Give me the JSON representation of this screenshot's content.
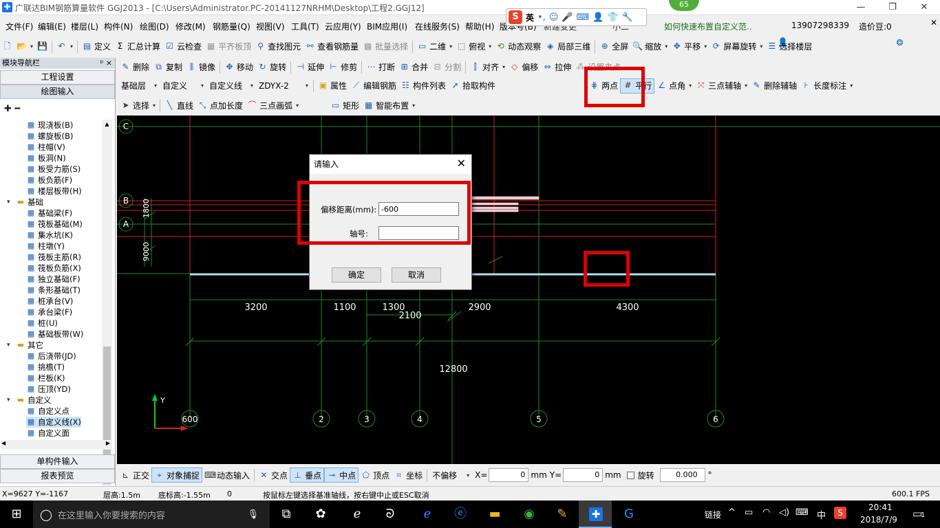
{
  "titlebar": {
    "title": "广联达BIM钢筋算量软件 GGJ2013 - [C:\\Users\\Administrator.PC-20141127NRHM\\Desktop\\工程2.GGJ12]",
    "min": "—",
    "max": "❐",
    "close": "✕"
  },
  "ime": {
    "label": "英",
    "badge": "65"
  },
  "menubar": {
    "items": [
      "文件(F)",
      "编辑(E)",
      "楼层(L)",
      "构件(N)",
      "绘图(D)",
      "修改(M)",
      "钢筋量(Q)",
      "视图(V)",
      "工具(T)",
      "云应用(Y)",
      "BIM应用(I)",
      "在线服务(S)",
      "帮助(H)",
      "版本号(B)",
      "新建变更",
      "小二"
    ],
    "tip": "如何快速布置自定义范..",
    "phone": "13907298339",
    "coins": "造价豆:0"
  },
  "toolbar1": {
    "items": [
      "定义",
      "汇总计算",
      "云检查",
      "平齐板顶",
      "查找图元",
      "查看钢筋量",
      "批量选择",
      "二维",
      "俯视",
      "动态观察",
      "局部三维",
      "全屏",
      "缩放",
      "平移",
      "屏幕旋转",
      "选择楼层"
    ]
  },
  "toolbar2": {
    "items": [
      "删除",
      "复制",
      "镜像",
      "移动",
      "旋转",
      "延伸",
      "修剪",
      "打断",
      "合并",
      "分割",
      "对齐",
      "偏移",
      "拉伸",
      "设置夹点"
    ]
  },
  "toolbar3": {
    "combos": [
      "基础层",
      "自定义",
      "自定义线",
      "ZDYX-2"
    ],
    "items": [
      "属性",
      "编辑钢筋",
      "构件列表",
      "拾取构件"
    ],
    "axis_items": [
      "两点",
      "平行",
      "点角",
      "三点辅轴",
      "删除辅轴",
      "长度标注"
    ]
  },
  "toolbar4": {
    "items": [
      "选择",
      "直线",
      "点加长度",
      "三点画弧",
      "矩形",
      "智能布置"
    ]
  },
  "nav": {
    "header": "模块导航栏",
    "pin": "ᵖ ×",
    "buttons": [
      "工程设置",
      "绘图输入"
    ],
    "bottom_buttons": [
      "单构件输入",
      "报表预览"
    ],
    "tree": [
      {
        "label": "现浇板(B)",
        "level": 2
      },
      {
        "label": "螺旋板(B)",
        "level": 2
      },
      {
        "label": "柱帽(V)",
        "level": 2
      },
      {
        "label": "板洞(N)",
        "level": 2
      },
      {
        "label": "板受力筋(S)",
        "level": 2
      },
      {
        "label": "板负筋(F)",
        "level": 2
      },
      {
        "label": "楼层板带(H)",
        "level": 2
      },
      {
        "label": "基础",
        "level": 1
      },
      {
        "label": "基础梁(F)",
        "level": 2
      },
      {
        "label": "筏板基础(M)",
        "level": 2
      },
      {
        "label": "集水坑(K)",
        "level": 2
      },
      {
        "label": "柱墩(Y)",
        "level": 2
      },
      {
        "label": "筏板主筋(R)",
        "level": 2
      },
      {
        "label": "筏板负筋(X)",
        "level": 2
      },
      {
        "label": "独立基础(F)",
        "level": 2
      },
      {
        "label": "条形基础(T)",
        "level": 2
      },
      {
        "label": "桩承台(V)",
        "level": 2
      },
      {
        "label": "承台梁(F)",
        "level": 2
      },
      {
        "label": "桩(U)",
        "level": 2
      },
      {
        "label": "基础板带(W)",
        "level": 2
      },
      {
        "label": "其它",
        "level": 1
      },
      {
        "label": "后浇带(JD)",
        "level": 2
      },
      {
        "label": "挑檐(T)",
        "level": 2
      },
      {
        "label": "栏板(K)",
        "level": 2
      },
      {
        "label": "压顶(YD)",
        "level": 2
      },
      {
        "label": "自定义",
        "level": 1
      },
      {
        "label": "自定义点",
        "level": 2
      },
      {
        "label": "自定义线(X)",
        "level": 2
      },
      {
        "label": "自定义面",
        "level": 2
      }
    ]
  },
  "canvas": {
    "axis_rows": [
      "C",
      "B",
      "A"
    ],
    "axis_cols": [
      "2",
      "3",
      "4",
      "5",
      "6"
    ],
    "col_first_label": "600",
    "dims_top": [
      "3200",
      "1100",
      "1300",
      "2900",
      "4300"
    ],
    "dim_mid": "2100",
    "dim_total": "12800",
    "left_dims": [
      "1800",
      "9000"
    ],
    "ucs_y": "Y"
  },
  "dialog": {
    "title": "请输入",
    "offset_label": "偏移距离(mm):",
    "offset_value": "-600",
    "axis_label": "轴号:",
    "axis_value": "",
    "ok": "确定",
    "cancel": "取消"
  },
  "snapbar": {
    "items": [
      "正交",
      "对象捕捉",
      "动态输入",
      "交点",
      "垂点",
      "中点",
      "顶点",
      "坐标"
    ],
    "offset_mode": "不偏移",
    "x_label": "X=",
    "x_value": "0",
    "y_label": "Y=",
    "y_value": "0",
    "unit": "mm",
    "rotate_label": "旋转",
    "rotate_value": "0.000",
    "deg": "°"
  },
  "status": {
    "coords": "X=9627 Y=-1167",
    "floor_height": "层高:1.5m",
    "bottom_height": "底标高:-1.55m",
    "value": "0",
    "hint": "按鼠标左键选择基准轴线，按右键中止或ESC取消",
    "fps": "600.1 FPS"
  },
  "taskbar": {
    "search_placeholder": "在这里输入你要搜索的内容",
    "tray_link": "链接",
    "ime": "中",
    "time": "20:41",
    "date": "2018/7/9",
    "notif": "1"
  }
}
